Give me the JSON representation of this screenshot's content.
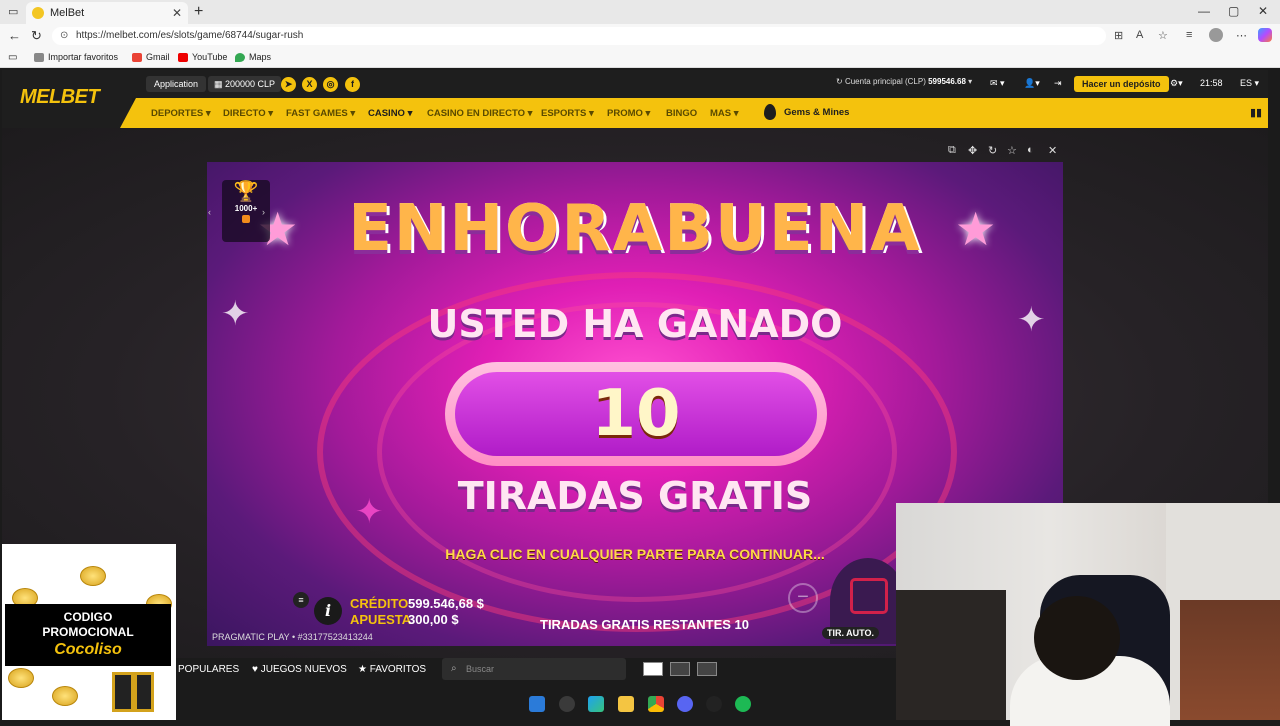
{
  "browser": {
    "tab_title": "MelBet",
    "url": "https://melbet.com/es/slots/game/68744/sugar-rush",
    "bookmarks": [
      "Importar favoritos",
      "Gmail",
      "YouTube",
      "Maps"
    ]
  },
  "site": {
    "logo": "MELBET",
    "header": {
      "app_label": "Application",
      "bonus_label": "200000 CLP",
      "account_label": "Cuenta principal (CLP)",
      "account_balance": "599546.68",
      "deposit_label": "Hacer un depósito",
      "time": "21:58",
      "lang": "ES"
    },
    "nav": [
      {
        "label": "DEPORTES ▾"
      },
      {
        "label": "DIRECTO ▾"
      },
      {
        "label": "FAST GAMES ▾"
      },
      {
        "label": "CASINO ▾"
      },
      {
        "label": "CASINO EN DIRECTO ▾"
      },
      {
        "label": "ESPORTS ▾"
      },
      {
        "label": "PROMO ▾"
      },
      {
        "label": "BINGO"
      },
      {
        "label": "MAS ▾"
      }
    ],
    "promo_nav": "Gems & Mines"
  },
  "game": {
    "title": "ENHORABUENA",
    "subtitle": "USTED HA GANADO",
    "count": "10",
    "prize": "TIRADAS GRATIS",
    "continue_text": "HAGA CLIC EN CUALQUIER PARTE PARA CONTINUAR...",
    "trophy_count": "1000+",
    "credit_label": "CRÉDITO",
    "credit_value": "599.546,68 $",
    "bet_label": "APUESTA",
    "bet_value": "300,00 $",
    "free_spins_left": "TIRADAS GRATIS RESTANTES 10",
    "provider": "PRAGMATIC PLAY • #33177523413244",
    "auto_label": "TIR. AUTO."
  },
  "bottom_bar": {
    "popular": "POPULARES",
    "new_games": "JUEGOS NUEVOS",
    "favorites": "FAVORITOS",
    "search_placeholder": "Buscar"
  },
  "promo": {
    "line1": "CODIGO",
    "line2": "PROMOCIONAL",
    "code": "Cocoliso"
  },
  "colors": {
    "brand_yellow": "#f4c20d",
    "header_dark": "#1e1e1e",
    "game_magenta": "#e01fb5"
  }
}
